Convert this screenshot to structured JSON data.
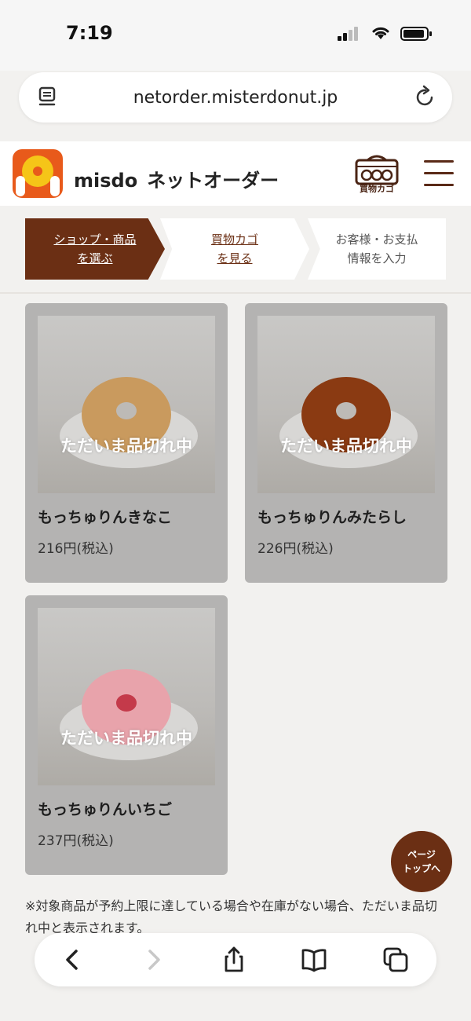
{
  "status_bar": {
    "time": "7:19"
  },
  "browser": {
    "url": "netorder.misterdonut.jp",
    "reader_icon": "reader-mode-icon",
    "reload_icon": "reload-icon"
  },
  "header": {
    "brand_latin": "misdo",
    "brand_ja": "ネットオーダー",
    "cart_label": "買物カゴ",
    "logo_icon": "misdo-logo",
    "menu_icon": "hamburger-menu-icon"
  },
  "steps": [
    {
      "line1": "ショップ・商品",
      "line2": "を選ぶ"
    },
    {
      "line1": "買物カゴ",
      "line2": "を見る"
    },
    {
      "line1": "お客様・お支払",
      "line2": "情報を入力"
    }
  ],
  "products": [
    {
      "name": "もっちゅりんきなこ",
      "price": "216円(税込)",
      "status": "ただいま品切れ中",
      "color": "#c99a5e"
    },
    {
      "name": "もっちゅりんみたらし",
      "price": "226円(税込)",
      "status": "ただいま品切れ中",
      "color": "#8a3a12"
    },
    {
      "name": "もっちゅりんいちご",
      "price": "237円(税込)",
      "status": "ただいま品切れ中",
      "color": "#e8a3ab"
    }
  ],
  "note": "※対象商品が予約上限に達している場合や在庫がない場合、ただいま品切れ中と表示されます。",
  "page_top": {
    "line1": "ページ",
    "line2": "トップへ"
  },
  "colors": {
    "brand_brown": "#6b2f14",
    "logo_orange": "#e85a1b",
    "logo_yellow": "#f5c518"
  }
}
